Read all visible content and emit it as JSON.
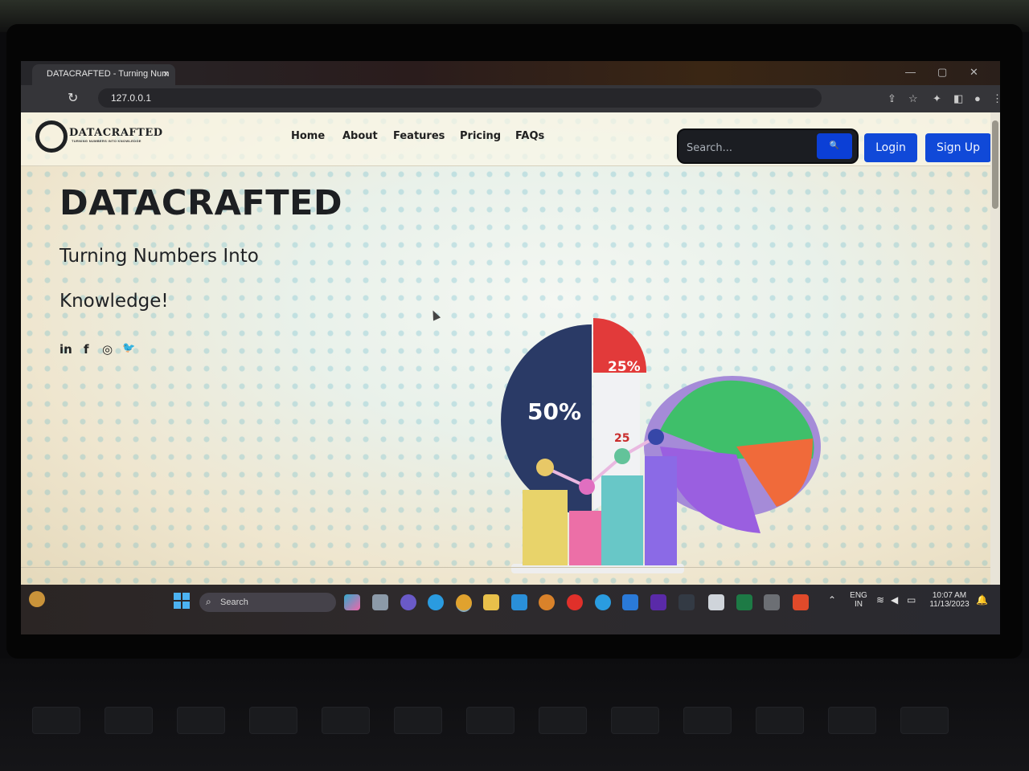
{
  "browser": {
    "tab_title": "DATACRAFTED - Turning Num",
    "tab_close": "×",
    "url": "127.0.0.1",
    "reload": "↻",
    "win_min": "—",
    "win_max": "▢",
    "win_close": "✕"
  },
  "site": {
    "logo_text": "DATACRAFTED",
    "logo_sub": "TURNING NUMBERS INTO KNOWLEDGE",
    "nav": [
      "Home",
      "About",
      "Features",
      "Pricing",
      "FAQs"
    ],
    "search_placeholder": "Search...",
    "search_icon": "🔍",
    "login": "Login",
    "signup": "Sign Up"
  },
  "hero": {
    "title": "DATACRAFTED",
    "line1": "Turning Numbers Into",
    "line2": "Knowledge!",
    "social": [
      "in",
      "f",
      "◎",
      "🐦"
    ],
    "pie_label_big": "50%",
    "pie_label_small": "25%",
    "pie_label_hidden": "25"
  },
  "taskbar": {
    "search": "Search",
    "lang_top": "ENG",
    "lang_bottom": "IN",
    "time": "10:07 AM",
    "date": "11/13/2023"
  }
}
